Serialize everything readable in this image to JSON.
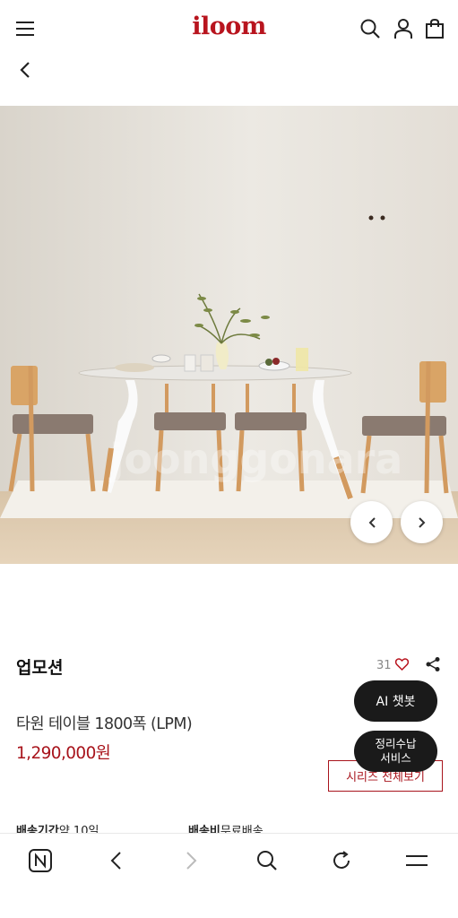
{
  "header": {
    "logo": "iloom",
    "icons": [
      "menu-icon",
      "search-icon",
      "user-icon",
      "shopping-bag-icon"
    ]
  },
  "product": {
    "name": "업모션",
    "likes": "31",
    "subtitle": "타원 테이블 1800폭 (LPM)",
    "price": "1,290,000원",
    "series_button": "시리즈 전체보기"
  },
  "floating": {
    "chatbot": "AI 챗봇",
    "storage_service": "정리수납\n서비스"
  },
  "delivery": {
    "period_label": "배송기간",
    "period_value": "약 10일",
    "fee_label": "배송비",
    "fee_value": "무료배송"
  },
  "watermark": "joonggonara",
  "colors": {
    "brand": "#b8141e",
    "price": "#a8141c",
    "floating_bg": "#1a1a1a"
  },
  "browser_nav": {
    "icons": [
      "naver-home-icon",
      "browser-back-icon",
      "browser-forward-icon",
      "browser-search-icon",
      "refresh-icon",
      "browser-menu-icon"
    ]
  }
}
